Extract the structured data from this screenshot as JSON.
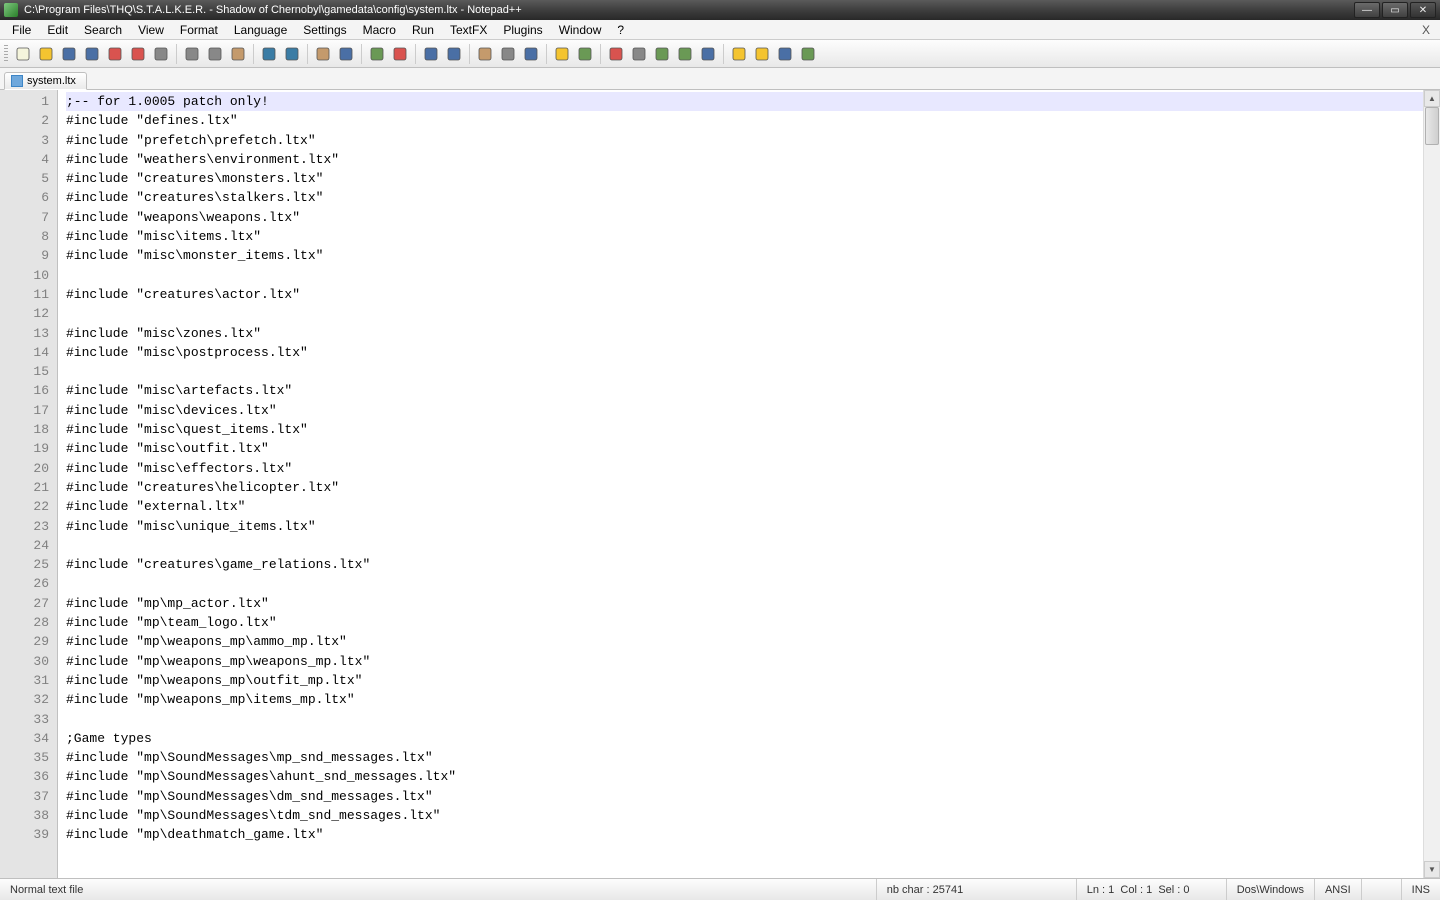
{
  "window": {
    "title": "C:\\Program Files\\THQ\\S.T.A.L.K.E.R. - Shadow of Chernobyl\\gamedata\\config\\system.ltx - Notepad++"
  },
  "menu": {
    "items": [
      "File",
      "Edit",
      "Search",
      "View",
      "Format",
      "Language",
      "Settings",
      "Macro",
      "Run",
      "TextFX",
      "Plugins",
      "Window",
      "?"
    ],
    "close": "X"
  },
  "toolbar_icons": [
    "new-file-icon",
    "open-file-icon",
    "save-icon",
    "save-all-icon",
    "close-icon",
    "close-all-icon",
    "print-icon",
    "sep",
    "cut-icon",
    "copy-icon",
    "paste-icon",
    "sep",
    "undo-icon",
    "redo-icon",
    "sep",
    "find-icon",
    "replace-icon",
    "sep",
    "zoom-in-icon",
    "zoom-out-icon",
    "sep",
    "sync-v-icon",
    "sync-h-icon",
    "sep",
    "wrap-icon",
    "show-all-icon",
    "indent-guide-icon",
    "sep",
    "folder-icon",
    "function-list-icon",
    "sep",
    "record-macro-icon",
    "stop-macro-icon",
    "play-macro-icon",
    "play-multi-icon",
    "save-macro-icon",
    "sep",
    "compare-icon",
    "clear-compare-icon",
    "first-diff-icon",
    "next-diff-icon"
  ],
  "tabs": [
    {
      "label": "system.ltx",
      "active": true
    }
  ],
  "editor": {
    "first_line": 1,
    "highlight_line": 1,
    "lines": [
      ";-- for 1.0005 patch only!",
      "#include \"defines.ltx\"",
      "#include \"prefetch\\prefetch.ltx\"",
      "#include \"weathers\\environment.ltx\"",
      "#include \"creatures\\monsters.ltx\"",
      "#include \"creatures\\stalkers.ltx\"",
      "#include \"weapons\\weapons.ltx\"",
      "#include \"misc\\items.ltx\"",
      "#include \"misc\\monster_items.ltx\"",
      "",
      "#include \"creatures\\actor.ltx\"",
      "",
      "#include \"misc\\zones.ltx\"",
      "#include \"misc\\postprocess.ltx\"",
      "",
      "#include \"misc\\artefacts.ltx\"",
      "#include \"misc\\devices.ltx\"",
      "#include \"misc\\quest_items.ltx\"",
      "#include \"misc\\outfit.ltx\"",
      "#include \"misc\\effectors.ltx\"",
      "#include \"creatures\\helicopter.ltx\"",
      "#include \"external.ltx\"",
      "#include \"misc\\unique_items.ltx\"",
      "",
      "#include \"creatures\\game_relations.ltx\"",
      "",
      "#include \"mp\\mp_actor.ltx\"",
      "#include \"mp\\team_logo.ltx\"",
      "#include \"mp\\weapons_mp\\ammo_mp.ltx\"",
      "#include \"mp\\weapons_mp\\weapons_mp.ltx\"",
      "#include \"mp\\weapons_mp\\outfit_mp.ltx\"",
      "#include \"mp\\weapons_mp\\items_mp.ltx\"",
      "",
      ";Game types",
      "#include \"mp\\SoundMessages\\mp_snd_messages.ltx\"",
      "#include \"mp\\SoundMessages\\ahunt_snd_messages.ltx\"",
      "#include \"mp\\SoundMessages\\dm_snd_messages.ltx\"",
      "#include \"mp\\SoundMessages\\tdm_snd_messages.ltx\"",
      "#include \"mp\\deathmatch_game.ltx\""
    ]
  },
  "statusbar": {
    "filetype": "Normal text file",
    "charcount_label": "nb char :",
    "charcount": "25741",
    "ln_label": "Ln :",
    "ln": "1",
    "col_label": "Col :",
    "col": "1",
    "sel_label": "Sel :",
    "sel": "0",
    "eol": "Dos\\Windows",
    "encoding": "ANSI",
    "mode": "INS"
  }
}
